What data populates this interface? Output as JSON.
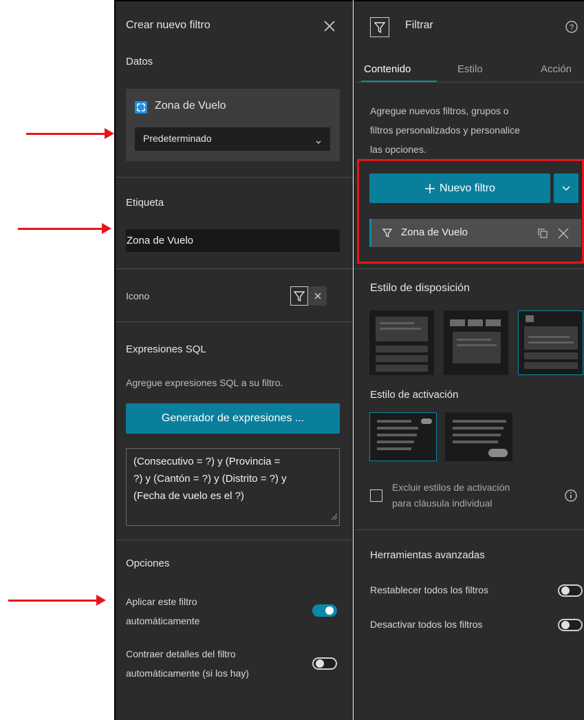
{
  "left": {
    "title": "Crear nuevo filtro",
    "data_section": "Datos",
    "layer_name": "Zona de Vuelo",
    "view_select": "Predeterminado",
    "label_section": "Etiqueta",
    "label_value": "Zona de Vuelo",
    "icon_section": "Icono",
    "sql_section": "Expresiones SQL",
    "sql_hint": "Agregue expresiones SQL a su filtro.",
    "builder_button": "Generador de expresiones ...",
    "sql_lines": [
      "(Consecutivo = ?) y (Provincia =",
      "?) y (Cantón = ?) y (Distrito = ?) y",
      "(Fecha de vuelo es el ?)"
    ],
    "options_section": "Opciones",
    "option1_lines": [
      "Aplicar este filtro",
      "automáticamente"
    ],
    "option1_on": true,
    "option2_lines": [
      "Contraer detalles del filtro",
      "automáticamente (si los hay)"
    ],
    "option2_on": false
  },
  "right": {
    "title": "Filtrar",
    "tabs": [
      "Contenido",
      "Estilo",
      "Acción"
    ],
    "active_tab": "Contenido",
    "description_lines": [
      "Agregue nuevos filtros, grupos o",
      "filtros personalizados y personalice",
      "las opciones."
    ],
    "new_filter_button": "Nuevo filtro",
    "filter_item": "Zona de Vuelo",
    "layout_style": "Estilo de disposición",
    "activation_style": "Estilo de activación",
    "exclude_lines": [
      "Excluir estilos de activación",
      "para cláusula individual"
    ],
    "advanced_tools": "Herramientas avanzadas",
    "reset_all": "Restablecer todos los filtros",
    "disable_all": "Desactivar todos los filtros"
  },
  "colors": {
    "panel_bg": "#2b2b2b",
    "accent": "#0a8aa8",
    "highlight_box": "#e8141b",
    "arrows": "#e8141b"
  },
  "icons": [
    "close-icon",
    "filter-icon",
    "help-icon",
    "plus-icon",
    "chevron-down-icon",
    "copy-icon",
    "info-icon",
    "layer-icon",
    "arrow-right-icon"
  ]
}
